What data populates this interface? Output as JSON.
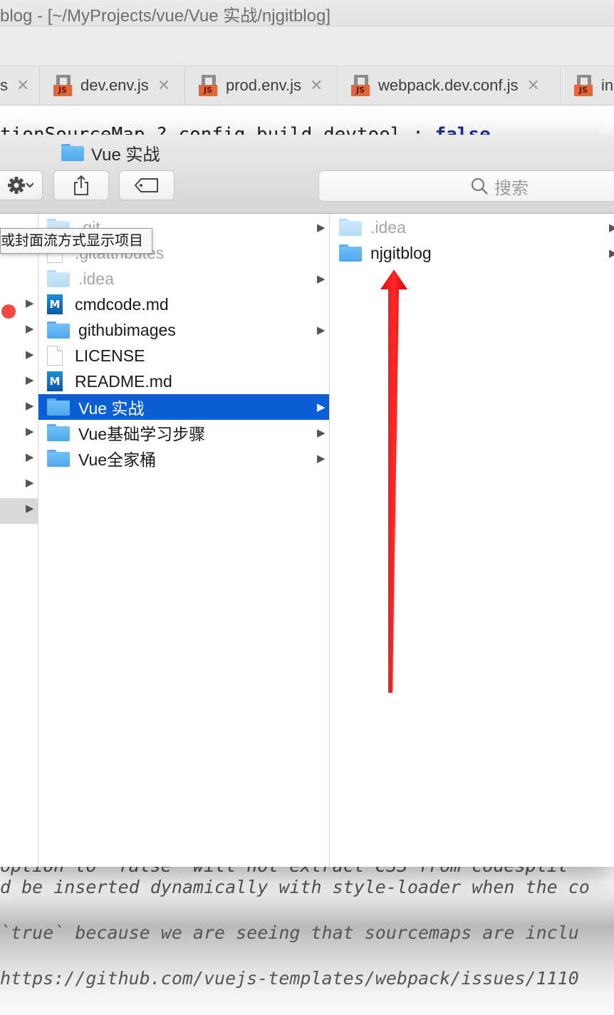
{
  "ide": {
    "title": "blog - [~/MyProjects/vue/Vue 实战/njgitblog]",
    "tabs": [
      {
        "label": "s",
        "close": "✕"
      },
      {
        "label": "dev.env.js",
        "close": "✕"
      },
      {
        "label": "prod.env.js",
        "close": "✕"
      },
      {
        "label": "webpack.dev.conf.js",
        "close": "✕"
      },
      {
        "label": "inc",
        "close": ""
      }
    ],
    "js_badge": "JS",
    "code_top": {
      "text": "tionSourceMap ? config.build.devtool : ",
      "keyword": "false"
    },
    "code_bottom": [
      "option to `false` will not extract CSS from codesplit",
      "d be inserted dynamically with style-loader when the co",
      " `true` because we are seeing that sourcemaps are inclu",
      " https://github.com/vuejs-templates/webpack/issues/1110"
    ]
  },
  "finder": {
    "title": "Vue 实战",
    "search_placeholder": "搜索",
    "tooltip": "或封面流方式显示项目",
    "column2": [
      {
        "label": ".git",
        "type": "folder",
        "dim": true,
        "arrow": true
      },
      {
        "label": ".gitattributes",
        "type": "file",
        "dim": true,
        "arrow": false
      },
      {
        "label": ".idea",
        "type": "folder",
        "dim": true,
        "arrow": true
      },
      {
        "label": "cmdcode.md",
        "type": "md",
        "dim": false,
        "arrow": false
      },
      {
        "label": "githubimages",
        "type": "folder",
        "dim": false,
        "arrow": true
      },
      {
        "label": "LICENSE",
        "type": "file",
        "dim": false,
        "arrow": false
      },
      {
        "label": "README.md",
        "type": "md",
        "dim": false,
        "arrow": false
      },
      {
        "label": "Vue 实战",
        "type": "folder",
        "dim": false,
        "arrow": true,
        "selected": true
      },
      {
        "label": "Vue基础学习步骤",
        "type": "folder",
        "dim": false,
        "arrow": true
      },
      {
        "label": "Vue全家桶",
        "type": "folder",
        "dim": false,
        "arrow": true
      }
    ],
    "column3": [
      {
        "label": ".idea",
        "type": "folder",
        "dim": true,
        "arrow": true
      },
      {
        "label": "njgitblog",
        "type": "folder",
        "dim": false,
        "arrow": true
      }
    ],
    "md_glyph": "M"
  },
  "colors": {
    "selection": "#0b5fd4",
    "folder": "#5aaef0",
    "tag_red": "#f04a44",
    "annotation_arrow": "#ff0000",
    "js_badge": "#e8643a"
  },
  "icons": {
    "gear": "gear-icon",
    "share": "share-icon",
    "tag": "tag-icon",
    "search": "search-icon",
    "disclosure": "▶"
  }
}
